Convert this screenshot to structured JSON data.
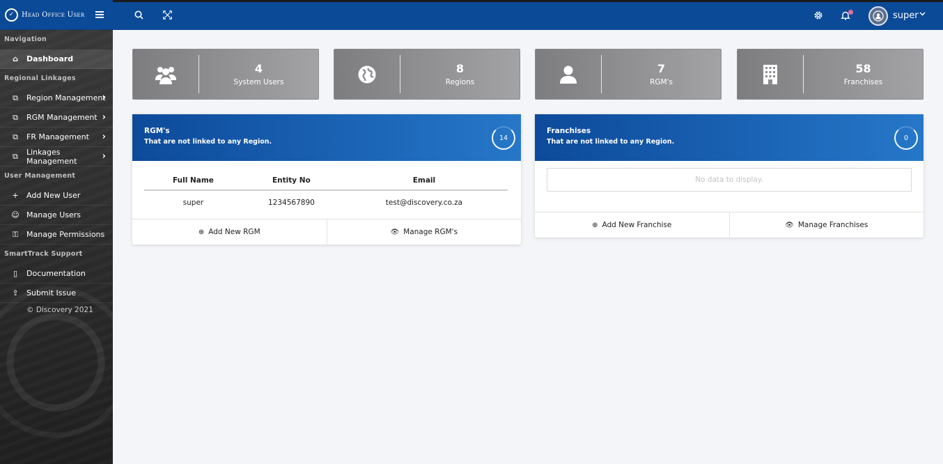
{
  "brand": {
    "title": "Head Office User",
    "logo_glyph": "✓"
  },
  "sidebar": {
    "sections": [
      {
        "label": "Navigation"
      },
      {
        "label": "Regional Linkages"
      },
      {
        "label": "User Management"
      },
      {
        "label": "SmartTrack Support"
      }
    ],
    "items": [
      {
        "label": "Dashboard",
        "icon": "home-icon"
      },
      {
        "label": "Region Management",
        "icon": "copy-icon"
      },
      {
        "label": "RGM Management",
        "icon": "copy-icon"
      },
      {
        "label": "FR Management",
        "icon": "copy-icon"
      },
      {
        "label": "Linkages Management",
        "icon": "copy-icon"
      },
      {
        "label": "Add New User",
        "icon": "plus-icon"
      },
      {
        "label": "Manage Users",
        "icon": "user-icon"
      },
      {
        "label": "Manage Permissions",
        "icon": "lock-icon"
      },
      {
        "label": "Documentation",
        "icon": "document-icon"
      },
      {
        "label": "Submit Issue",
        "icon": "upload-icon"
      }
    ],
    "caret": "›",
    "copyright": "© Discovery 2021"
  },
  "topbar": {
    "user_name": "super",
    "icons": [
      "search-icon",
      "fullscreen-icon",
      "gear-icon",
      "bell-icon",
      "avatar-icon"
    ]
  },
  "stats": [
    {
      "value": "4",
      "label": "System Users",
      "icon": "users-icon"
    },
    {
      "value": "8",
      "label": "Regions",
      "icon": "globe-icon"
    },
    {
      "value": "7",
      "label": "RGM's",
      "icon": "user-icon"
    },
    {
      "value": "58",
      "label": "Franchises",
      "icon": "building-icon"
    }
  ],
  "rgm_card": {
    "title": "RGM's",
    "subtitle": "That are not linked to any Region.",
    "count": "14",
    "columns": [
      "Full Name",
      "Entity No",
      "Email"
    ],
    "rows": [
      {
        "full_name": "super",
        "entity_no": "1234567890",
        "email": "test@discovery.co.za"
      }
    ],
    "add_label": "Add New RGM",
    "manage_label": "Manage RGM's"
  },
  "franchise_card": {
    "title": "Franchises",
    "subtitle": "That are not linked to any Region.",
    "count": "0",
    "empty_text": "No data to display.",
    "add_label": "Add New Franchise",
    "manage_label": "Manage Franchises"
  },
  "colors": {
    "primary": "#0b4a96",
    "accent": "#2677c9",
    "tile": "#8e8e91",
    "notification_dot": "#e66fa0"
  }
}
